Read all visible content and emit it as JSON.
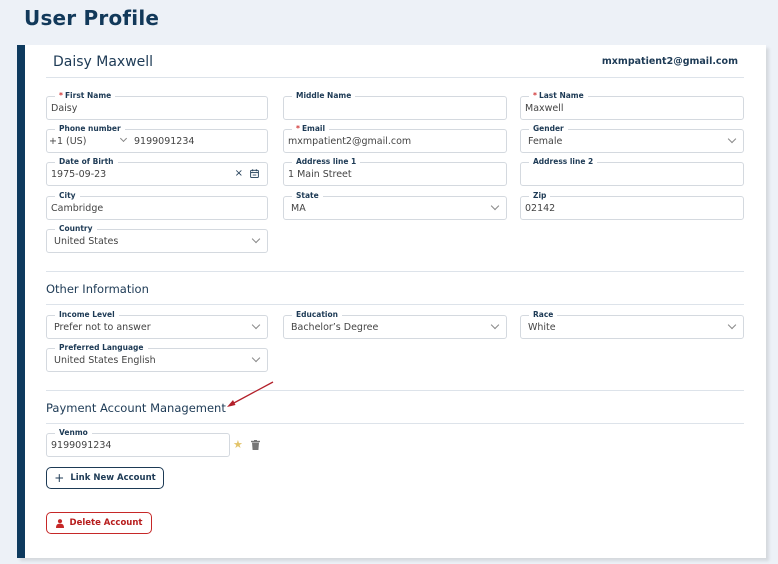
{
  "page": {
    "title": "User Profile"
  },
  "header": {
    "name": "Daisy Maxwell",
    "email": "mxmpatient2@gmail.com"
  },
  "personal": {
    "first_name": {
      "label": "First Name",
      "required": "*",
      "value": "Daisy"
    },
    "middle_name": {
      "label": "Middle Name",
      "value": ""
    },
    "last_name": {
      "label": "Last Name",
      "required": "*",
      "value": "Maxwell"
    },
    "phone": {
      "label": "Phone number",
      "country_code": "+1 (US)",
      "value": "9199091234"
    },
    "email": {
      "label": "Email",
      "required": "*",
      "value": "mxmpatient2@gmail.com"
    },
    "gender": {
      "label": "Gender",
      "value": "Female"
    },
    "dob": {
      "label": "Date of Birth",
      "value": "1975-09-23",
      "clear_glyph": "×"
    },
    "address1": {
      "label": "Address line 1",
      "value": "1 Main Street"
    },
    "address2": {
      "label": "Address line 2",
      "value": ""
    },
    "city": {
      "label": "City",
      "value": "Cambridge"
    },
    "state": {
      "label": "State",
      "value": "MA"
    },
    "zip": {
      "label": "Zip",
      "value": "02142"
    },
    "country": {
      "label": "Country",
      "value": "United States"
    }
  },
  "other": {
    "title": "Other Information",
    "income": {
      "label": "Income Level",
      "value": "Prefer not to answer"
    },
    "education": {
      "label": "Education",
      "value": "Bachelor’s Degree"
    },
    "race": {
      "label": "Race",
      "value": "White"
    },
    "language": {
      "label": "Preferred Language",
      "value": "United States English"
    }
  },
  "payment": {
    "title": "Payment Account Management",
    "venmo": {
      "label": "Venmo",
      "value": "9199091234"
    },
    "star_glyph": "★",
    "link_button": {
      "icon": "+",
      "label": "Link New Account"
    },
    "delete_button": {
      "label": "Delete Account"
    }
  },
  "colors": {
    "accent": "#0e3a5e",
    "danger": "#c62828",
    "annotation_arrow": "#b3202a"
  }
}
